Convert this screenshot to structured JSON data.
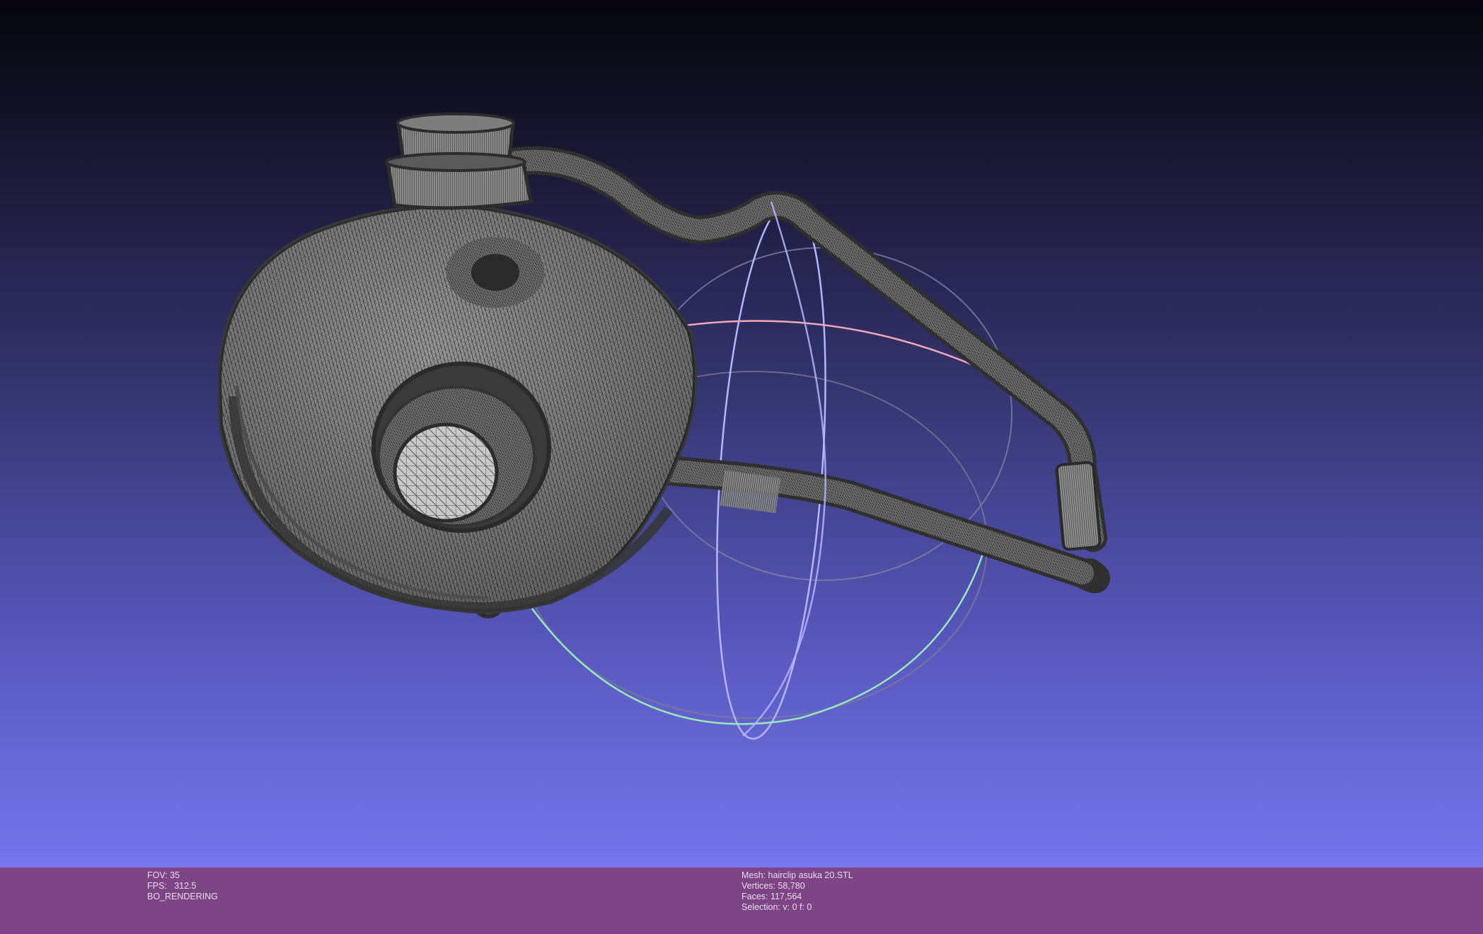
{
  "render_info": {
    "fov": "FOV: 35",
    "fps": "FPS:   312.5",
    "mode": "BO_RENDERING"
  },
  "mesh_info": {
    "mesh": "Mesh: hairclip asuka 20.STL",
    "vertices": "Vertices: 58,780",
    "faces": "Faces: 117,564",
    "selection": "Selection: v: 0 f: 0"
  },
  "colors": {
    "background_top": "#05050a",
    "background_bottom": "#7676ee",
    "info_bar": "#7d4585",
    "mesh_fill": "#8e8e8e",
    "mesh_wire": "#3a3a3a",
    "trackball_red": "#f0a0b0",
    "trackball_green": "#90e0b0",
    "trackball_blue": "#b0b0ff"
  }
}
